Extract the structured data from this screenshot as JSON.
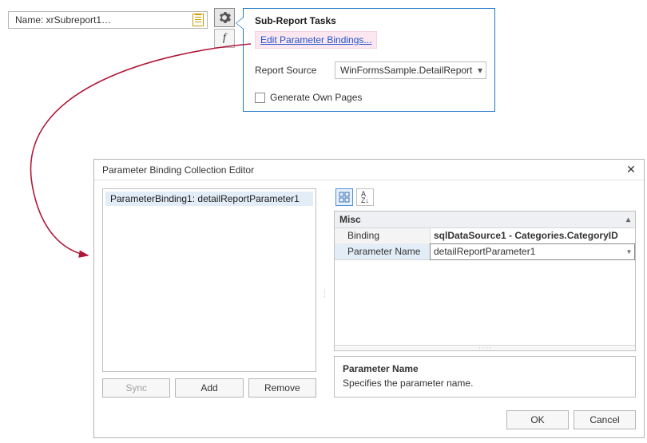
{
  "subreport": {
    "field_text": "Name: xrSubreport1…"
  },
  "tasks": {
    "title": "Sub-Report Tasks",
    "edit_link": "Edit Parameter Bindings...",
    "report_source_label": "Report Source",
    "report_source_value": "WinFormsSample.DetailReport",
    "generate_own_label": "Generate Own Pages",
    "generate_own_checked": false
  },
  "dialog": {
    "title": "Parameter Binding Collection Editor",
    "list_items": [
      "ParameterBinding1: detailReportParameter1"
    ],
    "sync_label": "Sync",
    "add_label": "Add",
    "remove_label": "Remove",
    "category_label": "Misc",
    "props": {
      "binding_label": "Binding",
      "binding_value": "sqlDataSource1 - Categories.CategoryID",
      "paramname_label": "Parameter Name",
      "paramname_value": "detailReportParameter1"
    },
    "desc": {
      "title": "Parameter Name",
      "text": "Specifies the parameter name."
    },
    "ok_label": "OK",
    "cancel_label": "Cancel"
  }
}
